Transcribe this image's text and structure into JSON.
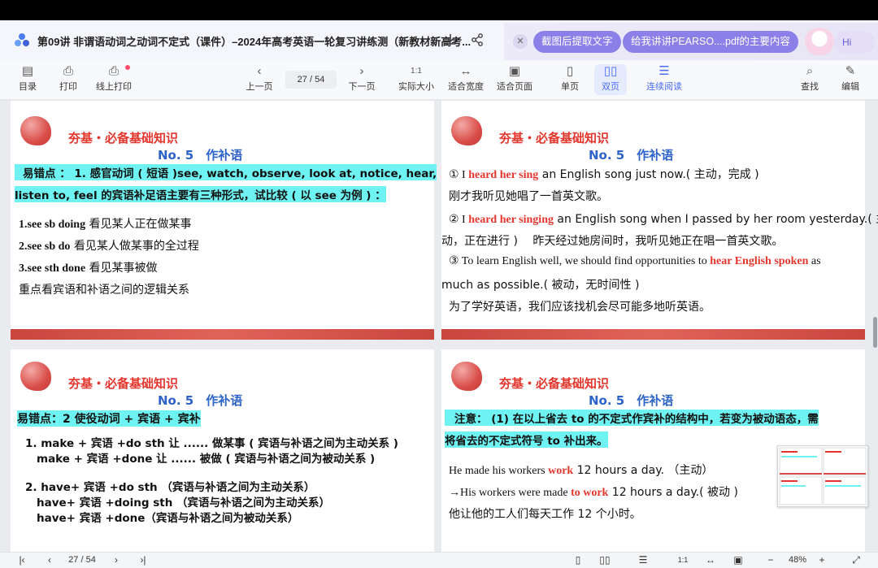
{
  "title_bar": {
    "doc_title": "第09讲 非谓语动词之动词不定式（课件）–2024年高考英语一轮复习讲练测（新教材新高考...",
    "chips": [
      "截图后提取文字",
      "给我讲讲PEARSO....pdf的主要内容"
    ],
    "assistant_greeting": "Hi",
    "icons": [
      "app-logo-icon",
      "download-icon",
      "share-icon",
      "close-icon"
    ]
  },
  "toolbar": {
    "left": [
      {
        "label": "目录",
        "icon": "toc-icon"
      },
      {
        "label": "打印",
        "icon": "print-icon"
      },
      {
        "label": "线上打印",
        "icon": "online-print-icon"
      }
    ],
    "prev_label": "上一页",
    "next_label": "下一页",
    "page_indicator": "27 / 54",
    "views": [
      {
        "label": "实际大小",
        "icon": "1:1"
      },
      {
        "label": "适合宽度",
        "icon": "fit-width-icon"
      },
      {
        "label": "适合页面",
        "icon": "fit-page-icon"
      },
      {
        "label": "单页",
        "icon": "single-page-icon"
      },
      {
        "label": "双页",
        "icon": "double-page-icon"
      },
      {
        "label": "连续阅读",
        "icon": "continuous-icon"
      }
    ],
    "right": [
      {
        "label": "查找",
        "icon": "search-icon"
      },
      {
        "label": "编辑",
        "icon": "edit-icon"
      }
    ],
    "active_color": "#4a6cf7"
  },
  "slides": {
    "header_red": "夯基・必备基础知识",
    "header_blue": "No. 5　作补语",
    "tl": {
      "l1a": "易错点 ： 1.  感官动词 ( 短语 )see, watch, observe, look at, notice, hear,",
      "l1b": "listen to, feel 的宾语补足语主要有三种形式，试比较 ( 以 see 为例 ) ：",
      "i1a": "1.see sb doing",
      "i1b": "  看见某人正在做某事",
      "i2a": "2.see sb do",
      "i2b": "  看见某人做某事的全过程",
      "i3a": "3.see sth done",
      "i3b": "  看见某事被做",
      "i4": "重点看宾语和补语之间的逻辑关系"
    },
    "tr": {
      "e1a": "① I ",
      "e1r": "heard her sing",
      "e1b": " an English song just now.( 主动，完成 )",
      "c1": "刚才我听见她唱了一首英文歌。",
      "e2a": "② I ",
      "e2r": "heard her singing",
      "e2b": " an English song when I passed by her room yesterday.( 主",
      "e2c": "动，正在进行 )　 昨天经过她房间时，我听见她正在唱一首英文歌。",
      "e3a": "③ To learn English well, we should find opportunities to ",
      "e3r": "hear English spoken",
      "e3b": " as",
      "e3c": "much as possible.( 被动，无时间性 )",
      "c3": "为了学好英语，我们应该找机会尽可能多地听英语。"
    },
    "bl": {
      "h": "易错点：2  使役动词 + 宾语 + 宾补",
      "m1": "1. make + 宾语 +do sth 让 ...... 做某事 ( 宾语与补语之间为主动关系 )",
      "m2": "make + 宾语 +done 让 ...... 被做 ( 宾语与补语之间为被动关系 )",
      "h1": "2. have+ 宾语 +do sth （宾语与补语之间为主动关系）",
      "h2": "have+ 宾语 +doing sth （宾语与补语之间为主动关系）",
      "h3": "have+ 宾语 +done（宾语与补语之间为被动关系）"
    },
    "br": {
      "n1": "注意： (1) 在以上省去 to 的不定式作宾补的结构中，若变为被动语态，需",
      "n2": "将省去的不定式符号 to 补出来。",
      "s1a": "He made his workers ",
      "s1r": "work",
      "s1b": " 12 hours a day. （主动）",
      "s2a": "→His workers were made ",
      "s2r": "to work",
      "s2b": " 12 hours a day.( 被动 )",
      "s3": "他让他的工人们每天工作 12 个小时。"
    }
  },
  "status_bar": {
    "page_indicator": "27 / 54",
    "zoom": "48%"
  }
}
